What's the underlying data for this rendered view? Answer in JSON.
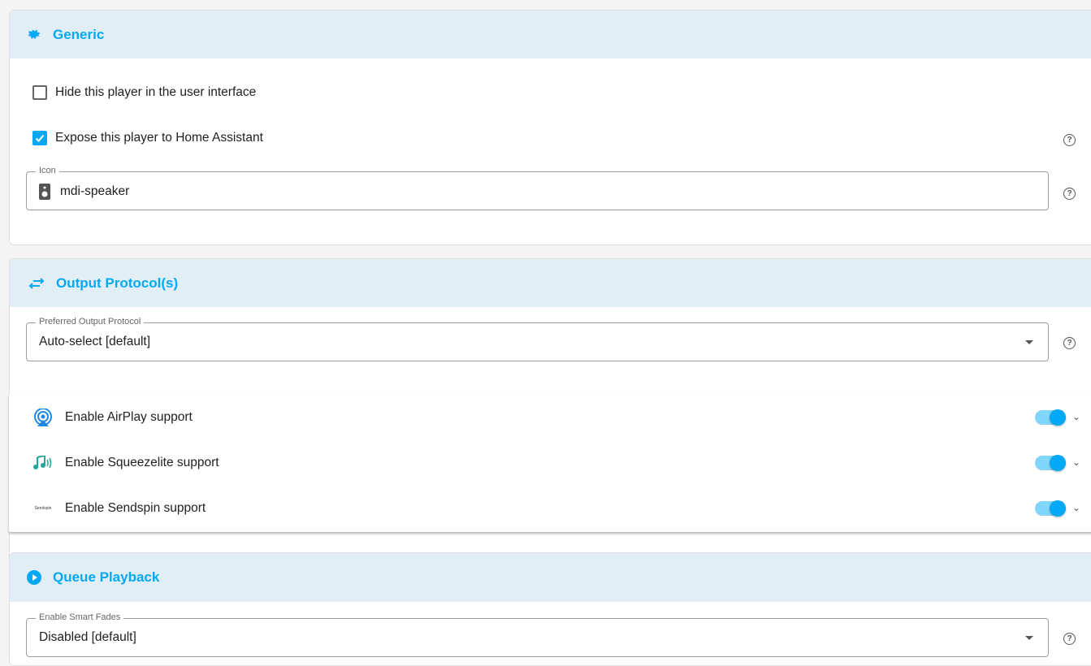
{
  "generic": {
    "title": "Generic",
    "hide_label": "Hide this player in the user interface",
    "hide_checked": false,
    "expose_label": "Expose this player to Home Assistant",
    "expose_checked": true,
    "icon_label": "Icon",
    "icon_value": "mdi-speaker"
  },
  "output": {
    "title": "Output Protocol(s)",
    "preferred_label": "Preferred Output Protocol",
    "preferred_value": "Auto-select [default]",
    "protocols": [
      {
        "label": "Enable AirPlay support",
        "enabled": true
      },
      {
        "label": "Enable Squeezelite support",
        "enabled": true
      },
      {
        "label": "Enable Sendspin support",
        "enabled": true,
        "logo_text": "Sendspin"
      }
    ]
  },
  "queue": {
    "title": "Queue Playback",
    "smart_fades_label": "Enable Smart Fades",
    "smart_fades_value": "Disabled [default]"
  },
  "colors": {
    "accent": "#03a9f4",
    "header_bg": "#e1eef5"
  }
}
